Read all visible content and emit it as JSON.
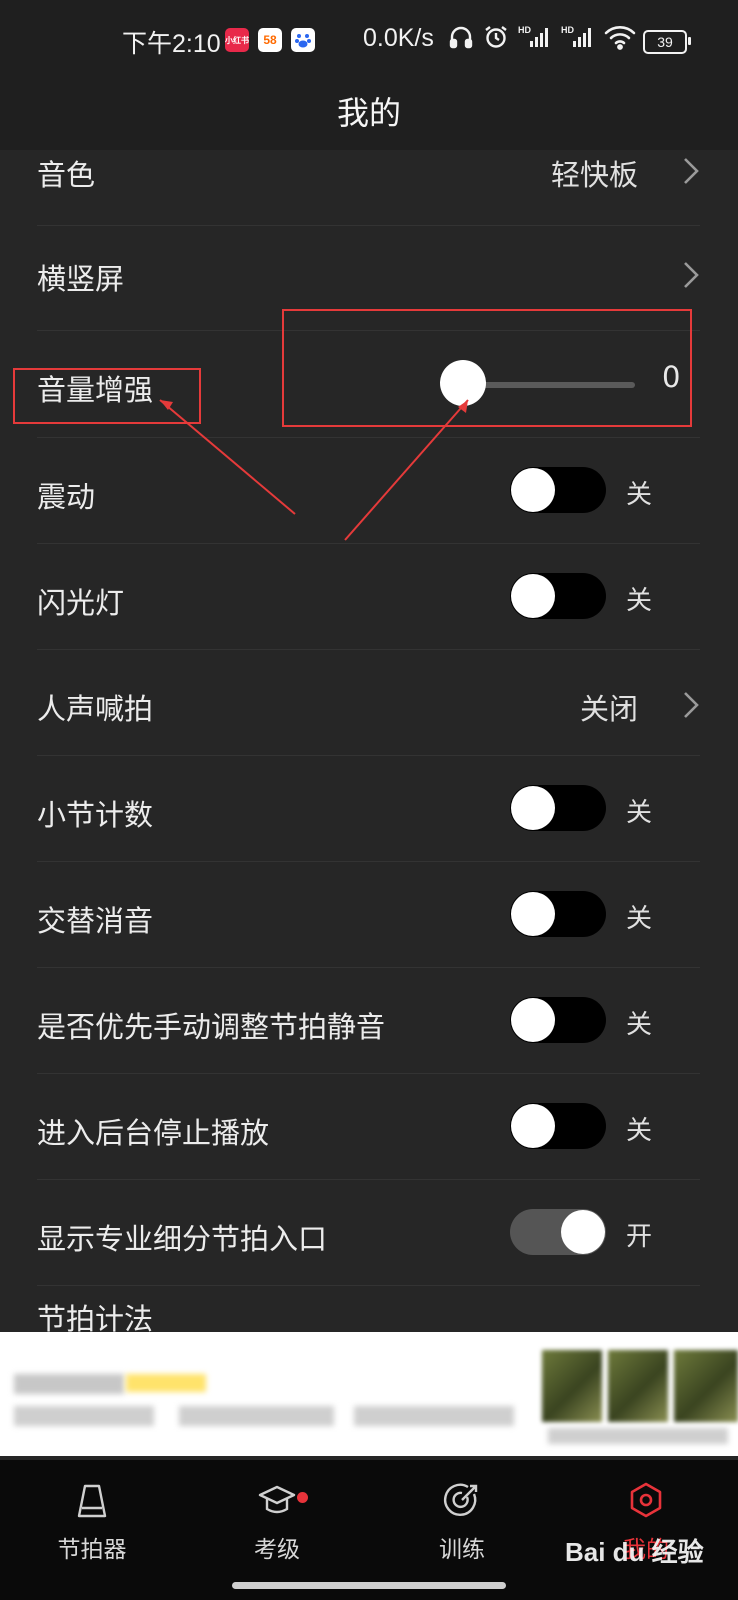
{
  "status_bar": {
    "time": "下午2:10",
    "apps": [
      "小红书",
      "58",
      "百度"
    ],
    "net_speed": "0.0K/s",
    "icons": [
      "headphones-icon",
      "alarm-icon",
      "hd-signal-icon",
      "hd-signal-icon",
      "wifi-icon"
    ],
    "battery": "39"
  },
  "header": {
    "title": "我的"
  },
  "settings": {
    "timbre": {
      "label": "音色",
      "value": "轻快板"
    },
    "orientation": {
      "label": "横竖屏"
    },
    "volume_boost": {
      "label": "音量增强",
      "value": "0",
      "level": 0
    },
    "vibration": {
      "label": "震动",
      "state": "关",
      "on": false
    },
    "flashlight": {
      "label": "闪光灯",
      "state": "关",
      "on": false
    },
    "voice_count": {
      "label": "人声喊拍",
      "value": "关闭"
    },
    "bar_count": {
      "label": "小节计数",
      "state": "关",
      "on": false
    },
    "alternate_mute": {
      "label": "交替消音",
      "state": "关",
      "on": false
    },
    "manual_mute_priority": {
      "label": "是否优先手动调整节拍静音",
      "state": "关",
      "on": false
    },
    "stop_in_background": {
      "label": "进入后台停止播放",
      "state": "关",
      "on": false
    },
    "show_pro_subdivision": {
      "label": "显示专业细分节拍入口",
      "state": "开",
      "on": true
    },
    "beat_notation": {
      "label": "节拍计法"
    }
  },
  "bottom_nav": {
    "items": [
      {
        "label": "节拍器",
        "icon": "metronome-icon"
      },
      {
        "label": "考级",
        "icon": "graduation-cap-icon"
      },
      {
        "label": "训练",
        "icon": "target-icon"
      },
      {
        "label": "我的",
        "icon": "settings-icon",
        "active": true
      }
    ]
  },
  "watermark": "Bai du 经验",
  "colors": {
    "background": "#262626",
    "accent": "#e8333a",
    "annotation": "#e53a3a"
  }
}
